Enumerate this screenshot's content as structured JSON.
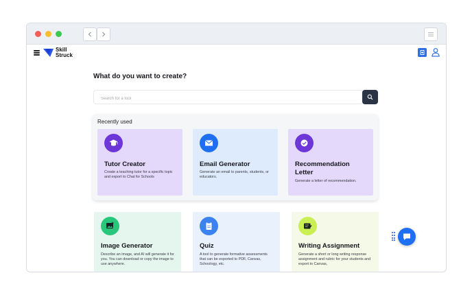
{
  "app": {
    "brand_line1": "Skill",
    "brand_line2": "Struck"
  },
  "colors": {
    "accent": "#1f6ff2",
    "dark_button": "#2b3445",
    "purple_card": "#e4d8fb",
    "blue_card": "#deebfd"
  },
  "main": {
    "title": "What do you want to create?",
    "search": {
      "placeholder": "Search for a tool",
      "value": ""
    }
  },
  "recent": {
    "label": "Recently used",
    "cards": [
      {
        "title": "Tutor Creator",
        "description": "Create a teaching tutor for a specific topic and export to Chat for Schools",
        "icon": "graduation-cap-icon"
      },
      {
        "title": "Email Generator",
        "description": "Generate an email to parents, students, or educators.",
        "icon": "envelope-icon"
      },
      {
        "title": "Recommendation Letter",
        "description": "Generate a letter of recommendation.",
        "icon": "check-badge-icon"
      }
    ]
  },
  "tools": [
    {
      "title": "Image Generator",
      "description": "Describe an image, and AI will generate it for you. You can download or copy the image to use anywhere.",
      "icon": "image-icon"
    },
    {
      "title": "Quiz",
      "description": "A tool to generate formative assessments that can be exported to PDF, Canvas, Schoology, etc.",
      "icon": "clipboard-icon"
    },
    {
      "title": "Writing Assignment",
      "description": "Generate a short or long writing response assignment and rubric for your students and export to Canvas,",
      "icon": "pencil-note-icon"
    }
  ]
}
